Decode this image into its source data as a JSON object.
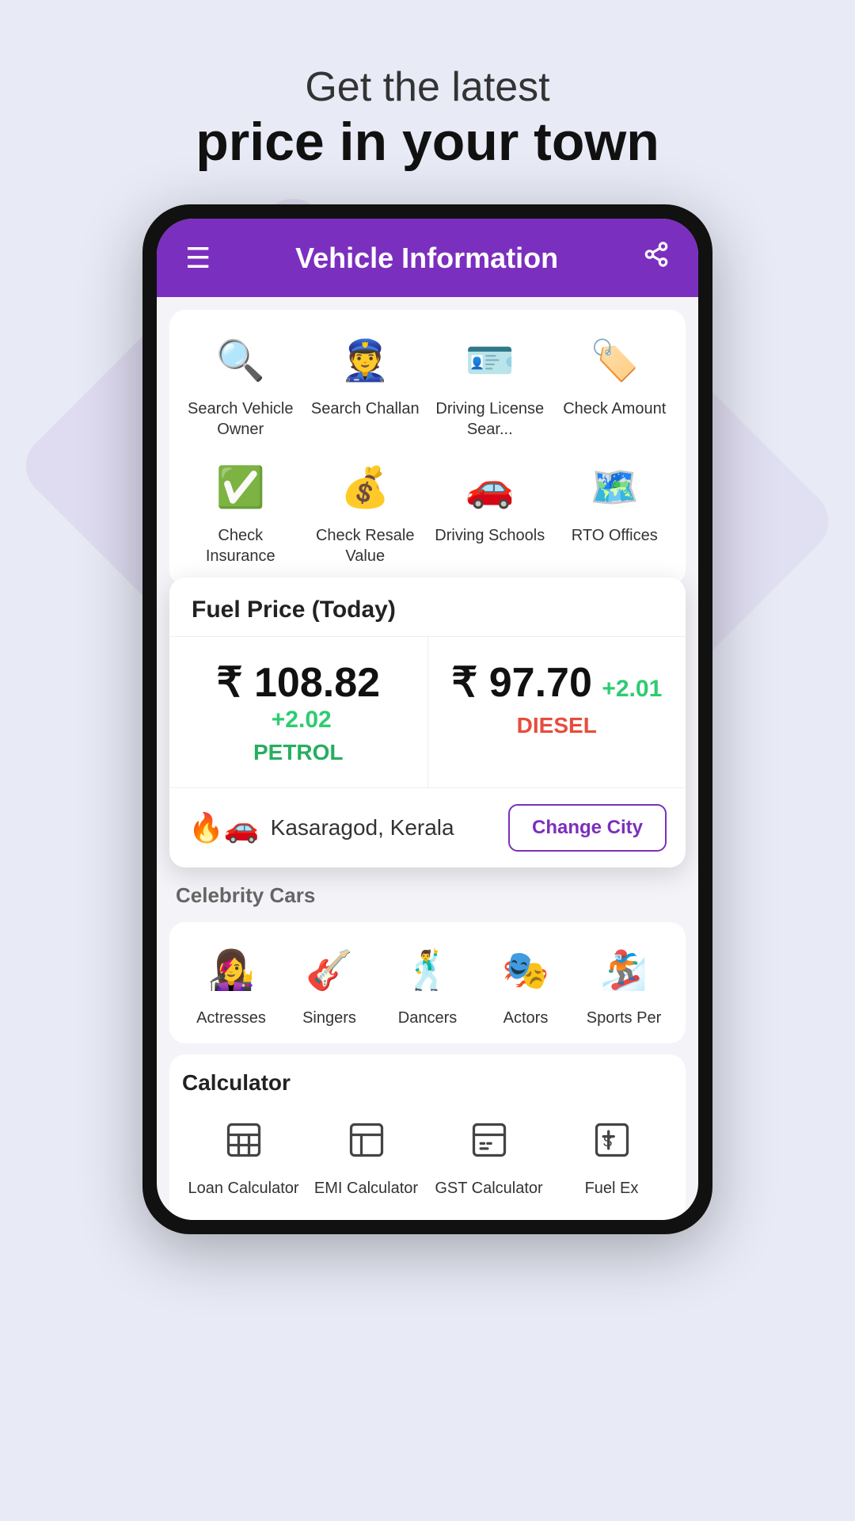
{
  "hero": {
    "sub_line": "Get the latest",
    "main_line": "price in your town"
  },
  "app_bar": {
    "title": "Vehicle Information"
  },
  "menu_items": [
    {
      "id": "search-vehicle-owner",
      "label": "Search Vehicle Owner",
      "icon": "🔍"
    },
    {
      "id": "search-challan",
      "label": "Search Challan",
      "icon": "👮"
    },
    {
      "id": "driving-license",
      "label": "Driving License Sear...",
      "icon": "🪪"
    },
    {
      "id": "check-amount",
      "label": "Check Amount",
      "icon": "🏷️"
    },
    {
      "id": "check-insurance",
      "label": "Check Insurance",
      "icon": "✅"
    },
    {
      "id": "check-resale-value",
      "label": "Check Resale Value",
      "icon": "💰"
    },
    {
      "id": "driving-schools",
      "label": "Driving Schools",
      "icon": "🚗"
    },
    {
      "id": "rto-offices",
      "label": "RTO Offices",
      "icon": "🗺️"
    }
  ],
  "fuel_card": {
    "header": "Fuel Price (Today)",
    "petrol": {
      "currency": "₹",
      "price": "108.82",
      "change": "+2.02",
      "label": "PETROL"
    },
    "diesel": {
      "currency": "₹",
      "price": "97.70",
      "change": "+2.01",
      "label": "DIESEL"
    },
    "location": "Kasaragod, Kerala",
    "change_city_btn": "Change City"
  },
  "celebrity_section": {
    "label": "Celebrity Cars",
    "items": [
      {
        "id": "actresses",
        "label": "Actresses",
        "icon": "👩‍🎤"
      },
      {
        "id": "singers",
        "label": "Singers",
        "icon": "🎸"
      },
      {
        "id": "dancers",
        "label": "Dancers",
        "icon": "🕺"
      },
      {
        "id": "actors",
        "label": "Actors",
        "icon": "🎭"
      },
      {
        "id": "sports-persons",
        "label": "Sports Per",
        "icon": "🏂"
      }
    ]
  },
  "calculator_section": {
    "header": "Calculator",
    "items": [
      {
        "id": "loan-calculator",
        "label": "Loan Calculator",
        "icon": "🧮"
      },
      {
        "id": "emi-calculator",
        "label": "EMI Calculator",
        "icon": "📊"
      },
      {
        "id": "gst-calculator",
        "label": "GST Calculator",
        "icon": "🧾"
      },
      {
        "id": "fuel-ex-calculator",
        "label": "Fuel Ex",
        "icon": "💵"
      }
    ]
  }
}
